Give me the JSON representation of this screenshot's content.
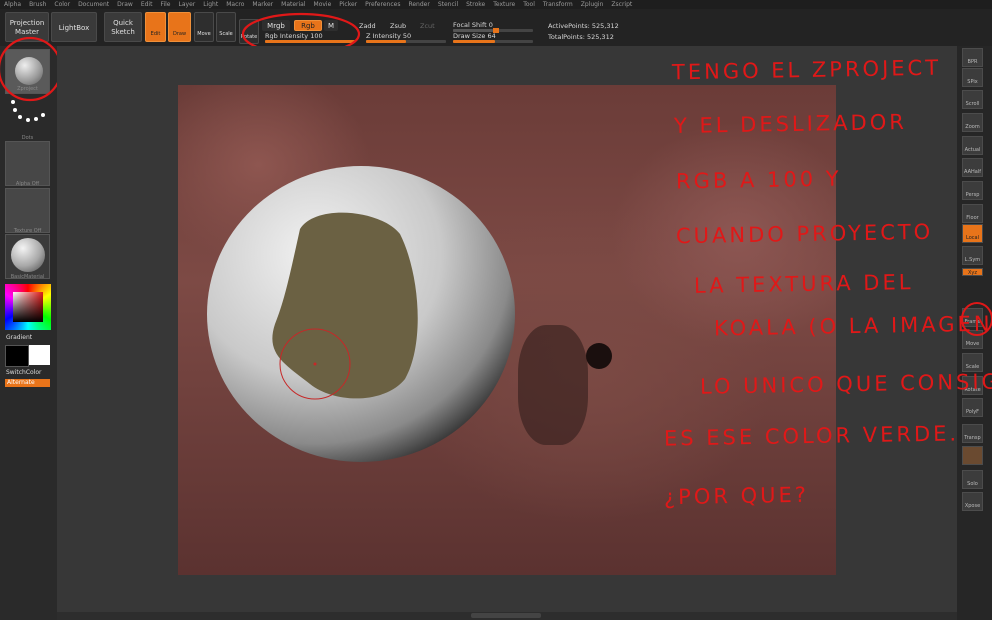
{
  "menu": [
    "Alpha",
    "Brush",
    "Color",
    "Document",
    "Draw",
    "Edit",
    "File",
    "Layer",
    "Light",
    "Macro",
    "Marker",
    "Material",
    "Movie",
    "Picker",
    "Preferences",
    "Render",
    "Stencil",
    "Stroke",
    "Texture",
    "Tool",
    "Transform",
    "Zplugin",
    "Zscript"
  ],
  "toolbar": {
    "projection_master": "Projection Master",
    "lightbox": "LightBox",
    "quick_sketch": "Quick Sketch",
    "edit": "Edit",
    "draw": "Draw",
    "move": "Move",
    "scale": "Scale",
    "rotate": "Rotate",
    "mrgb": "Mrgb",
    "rgb": "Rgb",
    "m": "M",
    "rgb_intensity_label": "Rgb Intensity",
    "rgb_intensity_value": "100",
    "rgb_intensity_fraction": 1.0,
    "zadd": "Zadd",
    "zsub": "Zsub",
    "zcut": "Zcut",
    "z_intensity_label": "Z Intensity",
    "z_intensity_value": "50",
    "z_intensity_fraction": 0.5,
    "focal_shift_label": "Focal Shift",
    "focal_shift_value": "0",
    "draw_size_label": "Draw Size",
    "draw_size_value": "64",
    "active_points": "ActivePoints: 525,312",
    "total_points": "TotalPoints: 525,312"
  },
  "left": {
    "zproject": "Zproject",
    "dots": "Dots",
    "alpha": "Alpha Off",
    "texture": "Texture Off",
    "material": "BasicMaterial",
    "gradient": "Gradient",
    "switchcolor": "SwitchColor",
    "alternate": "Alternate"
  },
  "right": [
    "BPR",
    "SPix",
    "Scroll",
    "Zoom",
    "Actual",
    "AAHalf",
    "Persp",
    "Floor",
    "Local",
    "L.Sym",
    "Xyz",
    "",
    "",
    "Frame",
    "Move",
    "Scale",
    "Rotate",
    "PolyF",
    "Transp",
    "",
    "Solo",
    "Xpose"
  ],
  "annotation_lines": [
    "TENGO EL ZPROJECT",
    "Y EL DESLIZADOR",
    "RGB A 100  Y",
    "CUANDO PROYECTO",
    "LA TEXTURA DEL",
    "KOALA (O LA IMAGEN)",
    "LO UNICO QUE CONSIGO",
    "ES ESE COLOR VERDE.",
    "¿POR QUE?"
  ],
  "colors": {
    "accent": "#e8741a",
    "annotation": "#e01818",
    "sphere_patch": "#6b6143"
  }
}
